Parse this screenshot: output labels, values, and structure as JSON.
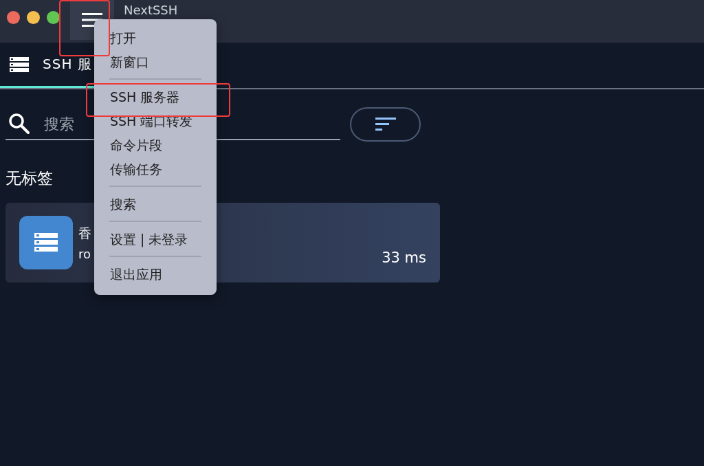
{
  "window": {
    "title": "NextSSH"
  },
  "tab": {
    "label": "SSH 服",
    "selected": true
  },
  "search": {
    "placeholder": "搜索"
  },
  "group": {
    "label": "无标签"
  },
  "servers": [
    {
      "name": "香",
      "user": "ro",
      "latency": "33 ms"
    }
  ],
  "menu": [
    {
      "kind": "item",
      "label": "打开"
    },
    {
      "kind": "item",
      "label": "新窗口"
    },
    {
      "kind": "separator"
    },
    {
      "kind": "item",
      "label": "SSH 服务器"
    },
    {
      "kind": "item",
      "label": "SSH 端口转发"
    },
    {
      "kind": "item",
      "label": "命令片段"
    },
    {
      "kind": "item",
      "label": "传输任务"
    },
    {
      "kind": "separator"
    },
    {
      "kind": "item",
      "label": "搜索"
    },
    {
      "kind": "separator"
    },
    {
      "kind": "item",
      "label": "设置 | 未登录"
    },
    {
      "kind": "separator"
    },
    {
      "kind": "item",
      "label": "退出应用"
    }
  ]
}
